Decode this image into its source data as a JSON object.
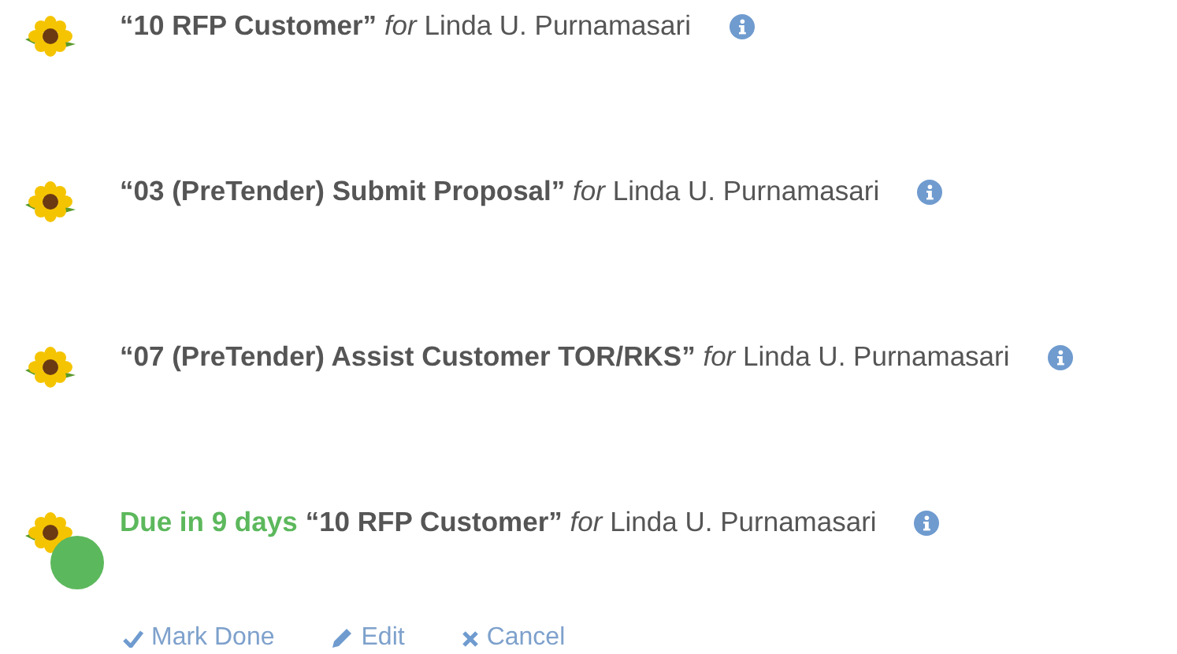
{
  "activities": [
    {
      "text": "**“10 RFP Customer”** *for* Linda U. Purnamasari"
    },
    {
      "text": "**“03 (PreTender) Submit Proposal”** *for* Linda U. Purnamasari"
    },
    {
      "text": "**“07 (PreTender) Assist Customer TOR/RKS”** *for* Linda U. Purnamasari"
    },
    {
      "due": "Due in 9 days",
      "text": "**“10 RFP Customer”** *for* Linda U. Purnamasari",
      "color": "#5cb85c",
      "actions": [
        {
          "kind": "done",
          "label": "Mark Done"
        },
        {
          "kind": "edit",
          "label": "Edit"
        },
        {
          "kind": "cancel",
          "label": "Cancel"
        }
      ]
    }
  ]
}
